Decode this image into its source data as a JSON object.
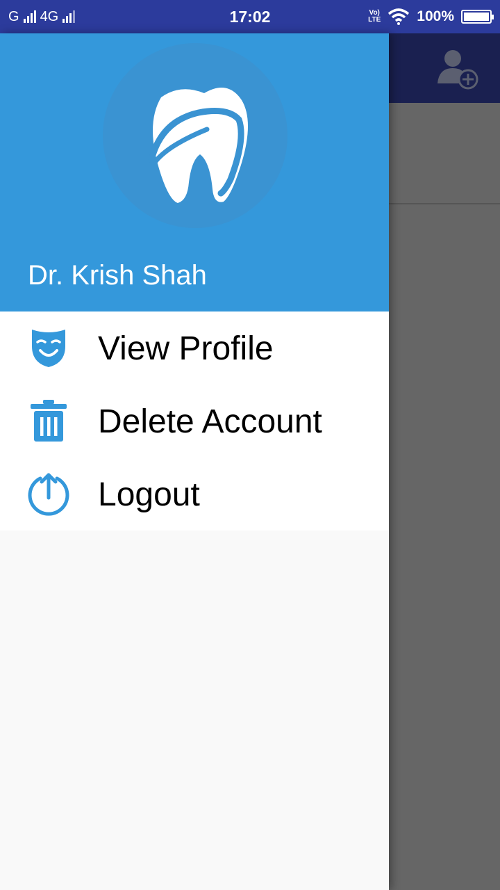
{
  "status_bar": {
    "carrier1": "G",
    "carrier2": "4G",
    "time": "17:02",
    "volte_top": "Vo)",
    "volte_bottom": "LTE",
    "battery": "100%"
  },
  "app_bar": {
    "action_icon": "add-user-icon"
  },
  "drawer": {
    "logo_icon": "tooth-icon",
    "user_name": "Dr. Krish Shah",
    "items": [
      {
        "label": "View Profile",
        "icon": "mask-icon"
      },
      {
        "label": "Delete Account",
        "icon": "trash-icon"
      },
      {
        "label": "Logout",
        "icon": "logout-icon"
      }
    ]
  },
  "colors": {
    "status_bar": "#2c3b9c",
    "header": "#3498db",
    "icon": "#3498db",
    "scrim": "#666666"
  }
}
